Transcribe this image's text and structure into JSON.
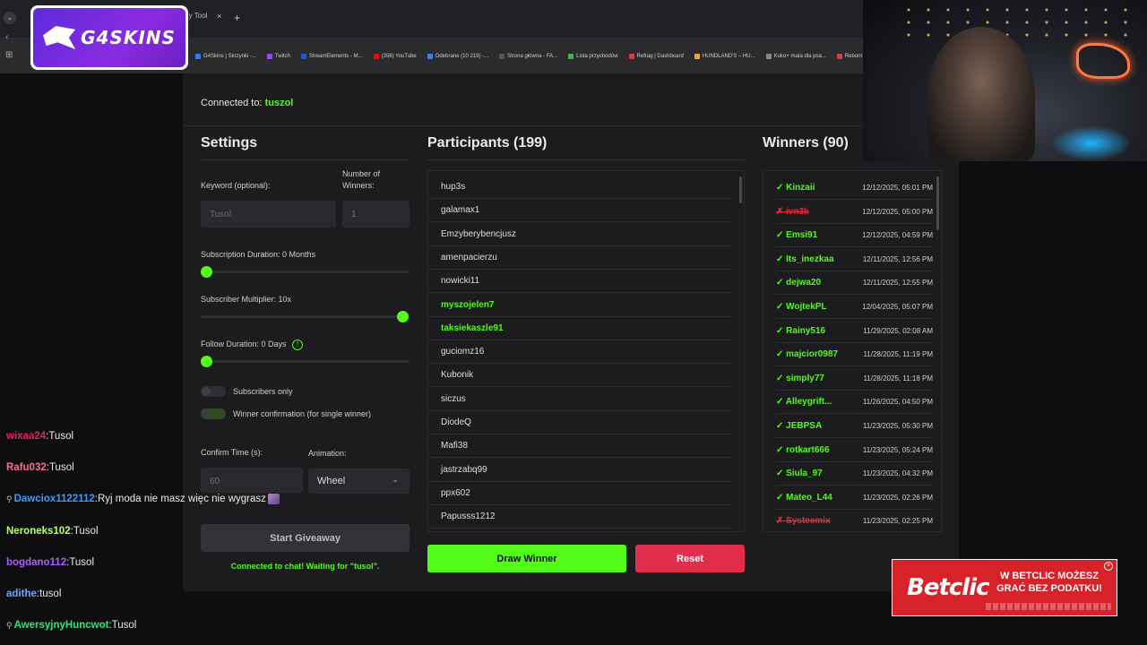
{
  "browser": {
    "tab_title": "away Tool",
    "tab_close": "×",
    "new_tab": "+",
    "bookmarks": [
      "G4Skins | Skrzynki -...",
      "Twitch",
      "StreamElements - M...",
      "(356) YouTube",
      "Odebrane (10 219) -...",
      "Strona główna - FA...",
      "Lista przychodów",
      "Refrag | Dashboard",
      "HUNDLAND'S – HU...",
      "Kuko+ mata dla psa...",
      "Reborn • The Ho"
    ]
  },
  "logo": {
    "text": "G4SKINS"
  },
  "app": {
    "connected_label": "Connected to:",
    "connected_user": "tuszol",
    "settings": {
      "title": "Settings",
      "keyword_label": "Keyword (optional):",
      "keyword_placeholder": "Tusol",
      "winners_label_1": "Number of",
      "winners_label_2": "Winners:",
      "winners_value": "1",
      "sub_duration_label": "Subscription Duration: 0 Months",
      "sub_duration_value": 0,
      "multiplier_label": "Subscriber Multiplier: 10x",
      "multiplier_value": 10,
      "follow_label": "Follow Duration: 0 Days",
      "follow_value": 0,
      "subs_only_label": "Subscribers only",
      "winner_confirm_label": "Winner confirmation (for single winner)",
      "confirm_time_label": "Confirm Time (s):",
      "confirm_time_value": "60",
      "animation_label": "Animation:",
      "animation_value": "Wheel",
      "start_button": "Start Giveaway",
      "status": "Connected to chat! Waiting for \"tusol\"."
    },
    "participants": {
      "title": "Participants (199)",
      "items": [
        {
          "name": "hup3s",
          "highlight": false
        },
        {
          "name": "galamax1",
          "highlight": false
        },
        {
          "name": "Emzyberybencjusz",
          "highlight": false
        },
        {
          "name": "amenpacierzu",
          "highlight": false
        },
        {
          "name": "nowicki11",
          "highlight": false
        },
        {
          "name": "myszojelen7",
          "highlight": true
        },
        {
          "name": "taksiekaszle91",
          "highlight": true
        },
        {
          "name": "guciomz16",
          "highlight": false
        },
        {
          "name": "Kubonik",
          "highlight": false
        },
        {
          "name": "siczus",
          "highlight": false
        },
        {
          "name": "DiodeQ",
          "highlight": false
        },
        {
          "name": "Mafi38",
          "highlight": false
        },
        {
          "name": "jastrzabq99",
          "highlight": false
        },
        {
          "name": "ppx602",
          "highlight": false
        },
        {
          "name": "Papusss1212",
          "highlight": false
        }
      ],
      "draw_button": "Draw Winner",
      "reset_button": "Reset"
    },
    "winners": {
      "title": "Winners (90)",
      "items": [
        {
          "name": "✓ Kinzaii",
          "date": "12/12/2025, 05:01 PM",
          "ok": true
        },
        {
          "name": "✗ ivn3k",
          "date": "12/12/2025, 05:00 PM",
          "ok": false
        },
        {
          "name": "✓ Emsi91",
          "date": "12/12/2025, 04:59 PM",
          "ok": true
        },
        {
          "name": "✓ Its_inezkaa",
          "date": "12/11/2025, 12:56 PM",
          "ok": true
        },
        {
          "name": "✓ dejwa20",
          "date": "12/11/2025, 12:55 PM",
          "ok": true
        },
        {
          "name": "✓ WojtekPL",
          "date": "12/04/2025, 05:07 PM",
          "ok": true
        },
        {
          "name": "✓ Rainy516",
          "date": "11/29/2025, 02:08 AM",
          "ok": true
        },
        {
          "name": "✓ majcior0987",
          "date": "11/28/2025, 11:19 PM",
          "ok": true
        },
        {
          "name": "✓ simply77",
          "date": "11/28/2025, 11:18 PM",
          "ok": true
        },
        {
          "name": "✓ Alleygrift...",
          "date": "11/26/2025, 04:50 PM",
          "ok": true
        },
        {
          "name": "✓ JEBPSA",
          "date": "11/23/2025, 05:30 PM",
          "ok": true
        },
        {
          "name": "✓ rotkart666",
          "date": "11/23/2025, 05:24 PM",
          "ok": true
        },
        {
          "name": "✓ Siula_97",
          "date": "11/23/2025, 04:32 PM",
          "ok": true
        },
        {
          "name": "✓ Mateo_L44",
          "date": "11/23/2025, 02:26 PM",
          "ok": true
        },
        {
          "name": "✗ Systeemix",
          "date": "11/23/2025, 02:25 PM",
          "ok": false
        }
      ]
    }
  },
  "chat": [
    {
      "user": "wixaa24",
      "color": "#e0245e",
      "msg": "Tusol",
      "prefix": ""
    },
    {
      "user": "Rafu032",
      "color": "#ff6b8b",
      "msg": "Tusol",
      "prefix": ""
    },
    {
      "user": "Dawciox1122112",
      "color": "#3d9bff",
      "msg": "Ryj moda nie masz więc nie wygrasz",
      "prefix": "⚲",
      "emote": true
    },
    {
      "user": "Neroneks102",
      "color": "#b9ff6a",
      "msg": "Tusol",
      "prefix": ""
    },
    {
      "user": "bogdano112",
      "color": "#b05cff",
      "msg": "Tusol",
      "prefix": ""
    },
    {
      "user": "adithe",
      "color": "#6fa8ff",
      "msg": "tusol",
      "prefix": ""
    },
    {
      "user": "AwersyjnyHuncwot",
      "color": "#2ee67a",
      "msg": "Tusol",
      "prefix": "⚲"
    }
  ],
  "ad": {
    "brand": "Betclic",
    "message": "W BETCLIC MOŻESZ GRAĆ BEZ PODATKU!",
    "close": "×"
  },
  "colors": {
    "accent": "#53fc18",
    "danger": "#e12e38",
    "panel": "#1c1c1f"
  }
}
